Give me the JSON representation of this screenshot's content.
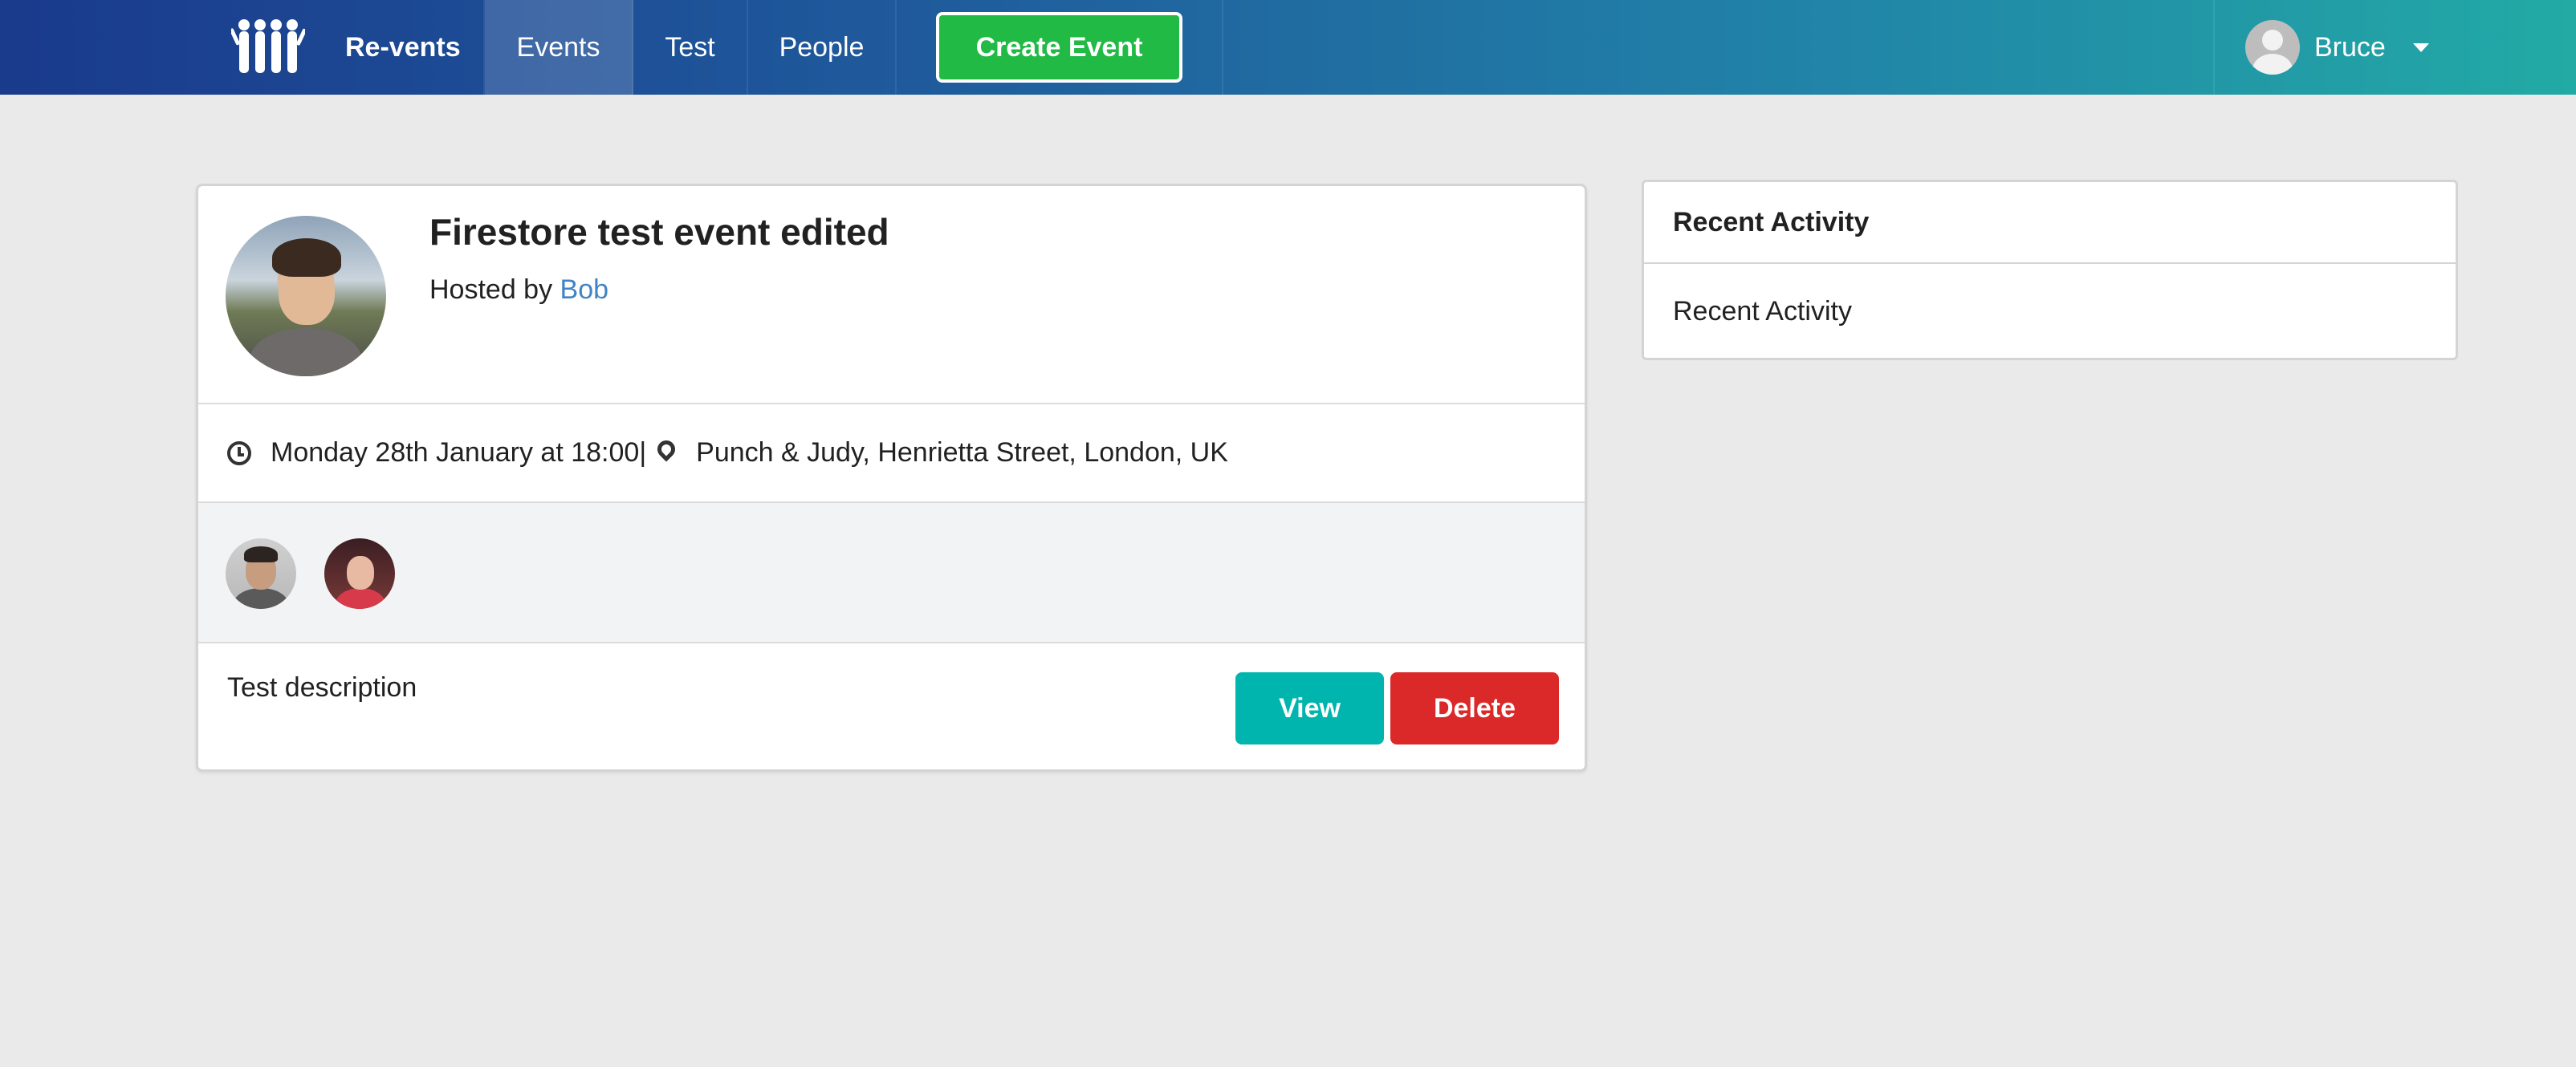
{
  "navbar": {
    "brand": "Re-vents",
    "items": [
      {
        "label": "Events"
      },
      {
        "label": "Test"
      },
      {
        "label": "People"
      }
    ],
    "create_label": "Create Event",
    "user_name": "Bruce",
    "colors": {
      "gradient_start": "#1a3a8c",
      "gradient_end": "#22aaa5",
      "create_button": "#21ba45"
    }
  },
  "event": {
    "title": "Firestore test event edited",
    "hosted_prefix": "Hosted by",
    "host": "Bob",
    "datetime": "Monday 28th January at 18:00|",
    "venue": "Punch & Judy, Henrietta Street, London, UK",
    "description": "Test description",
    "view_label": "View",
    "delete_label": "Delete",
    "colors": {
      "view": "#00b5ad",
      "delete": "#db2828",
      "link": "#4183c4"
    }
  },
  "activity": {
    "header": "Recent Activity",
    "body": "Recent Activity"
  },
  "icons": [
    "logo-people-icon",
    "user-avatar-icon",
    "caret-down-icon",
    "clock-icon",
    "map-marker-icon"
  ]
}
